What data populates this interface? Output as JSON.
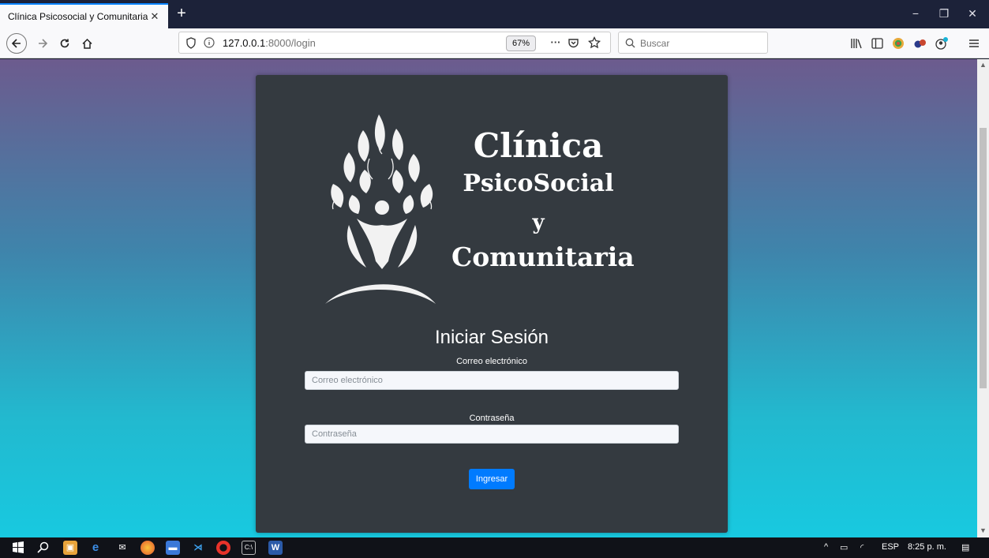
{
  "browser": {
    "tab_title": "Clínica Psicosocial y Comunitaria",
    "tab_close": "✕",
    "new_tab": "+",
    "minimize": "−",
    "restore": "❐",
    "close": "✕"
  },
  "navbar": {
    "url_host": "127.0.0.1",
    "url_path": ":8000/login",
    "zoom": "67%",
    "search_placeholder": "Buscar",
    "page_actions": "···"
  },
  "page": {
    "brand_line1": "Clínica",
    "brand_line2": "PsicoSocial",
    "brand_line3": "y",
    "brand_line4": "Comunitaria",
    "login_title": "Iniciar Sesión",
    "email_label": "Correo electrónico",
    "email_placeholder": "Correo electrónico",
    "password_label": "Contraseña",
    "password_placeholder": "Contraseña",
    "submit_label": "Ingresar"
  },
  "taskbar": {
    "language": "ESP",
    "time": "8:25 p. m."
  },
  "colors": {
    "card_bg": "#343a40",
    "primary_button": "#007bff",
    "gradient_top": "#6c5b8e",
    "gradient_bottom": "#18c9e0"
  },
  "icons": [
    "firefox-tab",
    "back-arrow-icon",
    "forward-arrow-icon",
    "reload-icon",
    "home-icon",
    "shield-icon",
    "info-icon",
    "pocket-icon",
    "bookmark-star-icon",
    "search-icon",
    "library-icon",
    "sidebar-icon",
    "extension-icon",
    "account-icon",
    "menu-icon"
  ]
}
